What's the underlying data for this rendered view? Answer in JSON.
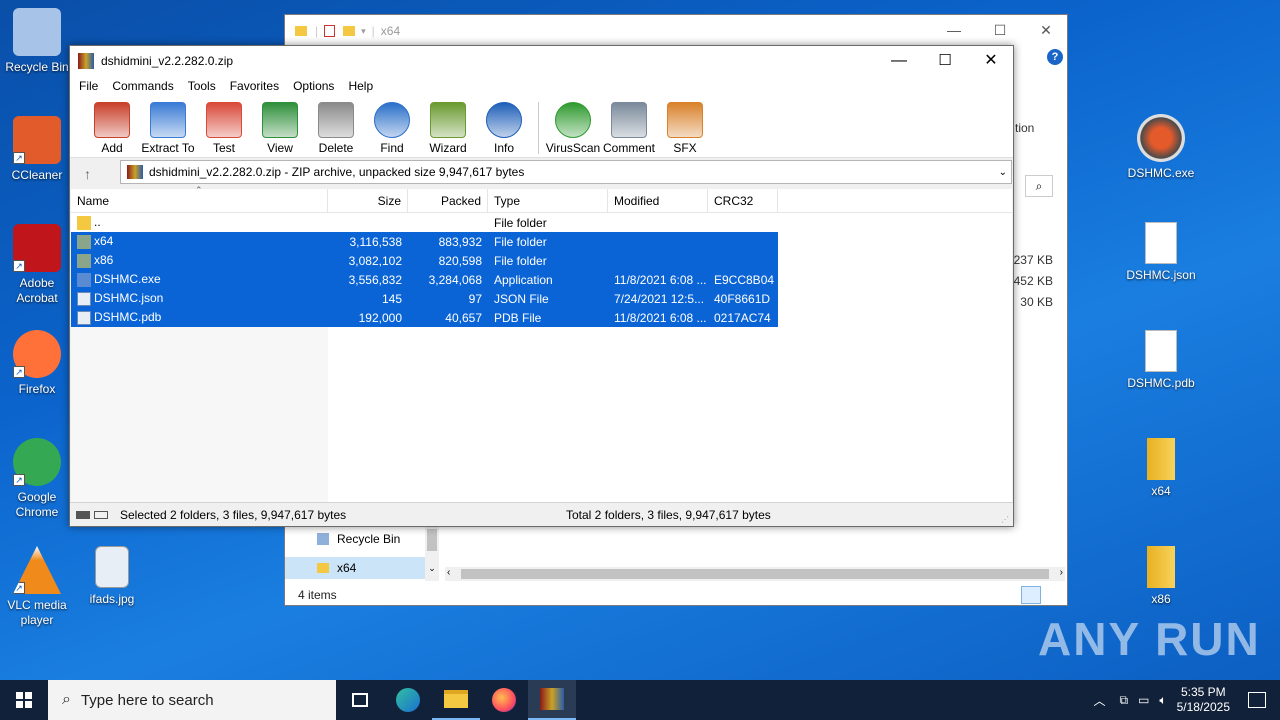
{
  "desktop": {
    "icons_left": [
      {
        "label": "Recycle Bin",
        "icon": "recycle-bin-icon"
      },
      {
        "label": "CCleaner",
        "icon": "ccleaner-icon"
      },
      {
        "label": "Adobe Acrobat",
        "icon": "acrobat-icon"
      },
      {
        "label": "Firefox",
        "icon": "firefox-icon"
      },
      {
        "label": "Google Chrome",
        "icon": "chrome-icon"
      },
      {
        "label": "VLC media player",
        "icon": "vlc-icon"
      },
      {
        "label": "ifads.jpg",
        "icon": "image-file-icon"
      }
    ],
    "icons_right": [
      {
        "label": "DSHMC.exe",
        "icon": "gamepad-exe-icon"
      },
      {
        "label": "DSHMC.json",
        "icon": "file-icon"
      },
      {
        "label": "DSHMC.pdb",
        "icon": "file-icon"
      },
      {
        "label": "x64",
        "icon": "folder-icon"
      },
      {
        "label": "x86",
        "icon": "folder-icon"
      }
    ],
    "watermark": "ANY RUN"
  },
  "explorer": {
    "title": "x64",
    "partial_label": "tion",
    "sizes": [
      "237 KB",
      ",452 KB",
      "30 KB"
    ],
    "nav_items": [
      "Recycle Bin",
      "x64"
    ],
    "status": "4 items"
  },
  "winrar": {
    "title": "dshidmini_v2.2.282.0.zip",
    "menu": [
      "File",
      "Commands",
      "Tools",
      "Favorites",
      "Options",
      "Help"
    ],
    "toolbar": [
      {
        "label": "Add",
        "color": "#c8402a"
      },
      {
        "label": "Extract To",
        "color": "#3a7bd5"
      },
      {
        "label": "Test",
        "color": "#d94a3a"
      },
      {
        "label": "View",
        "color": "#2f8f3a"
      },
      {
        "label": "Delete",
        "color": "#8a8a8a"
      },
      {
        "label": "Find",
        "color": "#2a6fc9"
      },
      {
        "label": "Wizard",
        "color": "#6a9a30"
      },
      {
        "label": "Info",
        "color": "#1f5fb8"
      },
      {
        "label": "VirusScan",
        "color": "#2f9a2f"
      },
      {
        "label": "Comment",
        "color": "#7a8a9a"
      },
      {
        "label": "SFX",
        "color": "#d9822b"
      }
    ],
    "address": "dshidmini_v2.2.282.0.zip - ZIP archive, unpacked size 9,947,617 bytes",
    "columns": [
      "Name",
      "Size",
      "Packed",
      "Type",
      "Modified",
      "CRC32"
    ],
    "rows": [
      {
        "name": "..",
        "size": "",
        "packed": "",
        "type": "File folder",
        "modified": "",
        "crc": "",
        "selected": false,
        "icon": "folder"
      },
      {
        "name": "x64",
        "size": "3,116,538",
        "packed": "883,932",
        "type": "File folder",
        "modified": "",
        "crc": "",
        "selected": true,
        "icon": "folder"
      },
      {
        "name": "x86",
        "size": "3,082,102",
        "packed": "820,598",
        "type": "File folder",
        "modified": "",
        "crc": "",
        "selected": true,
        "icon": "folder"
      },
      {
        "name": "DSHMC.exe",
        "size": "3,556,832",
        "packed": "3,284,068",
        "type": "Application",
        "modified": "11/8/2021 6:08 ...",
        "crc": "E9CC8B04",
        "selected": true,
        "icon": "exe"
      },
      {
        "name": "DSHMC.json",
        "size": "145",
        "packed": "97",
        "type": "JSON File",
        "modified": "7/24/2021 12:5...",
        "crc": "40F8661D",
        "selected": true,
        "icon": "file"
      },
      {
        "name": "DSHMC.pdb",
        "size": "192,000",
        "packed": "40,657",
        "type": "PDB File",
        "modified": "11/8/2021 6:08 ...",
        "crc": "0217AC74",
        "selected": true,
        "icon": "file"
      }
    ],
    "status_left": "Selected 2 folders, 3 files, 9,947,617 bytes",
    "status_right": "Total 2 folders, 3 files, 9,947,617 bytes"
  },
  "taskbar": {
    "search_placeholder": "Type here to search",
    "time": "5:35 PM",
    "date": "5/18/2025"
  }
}
